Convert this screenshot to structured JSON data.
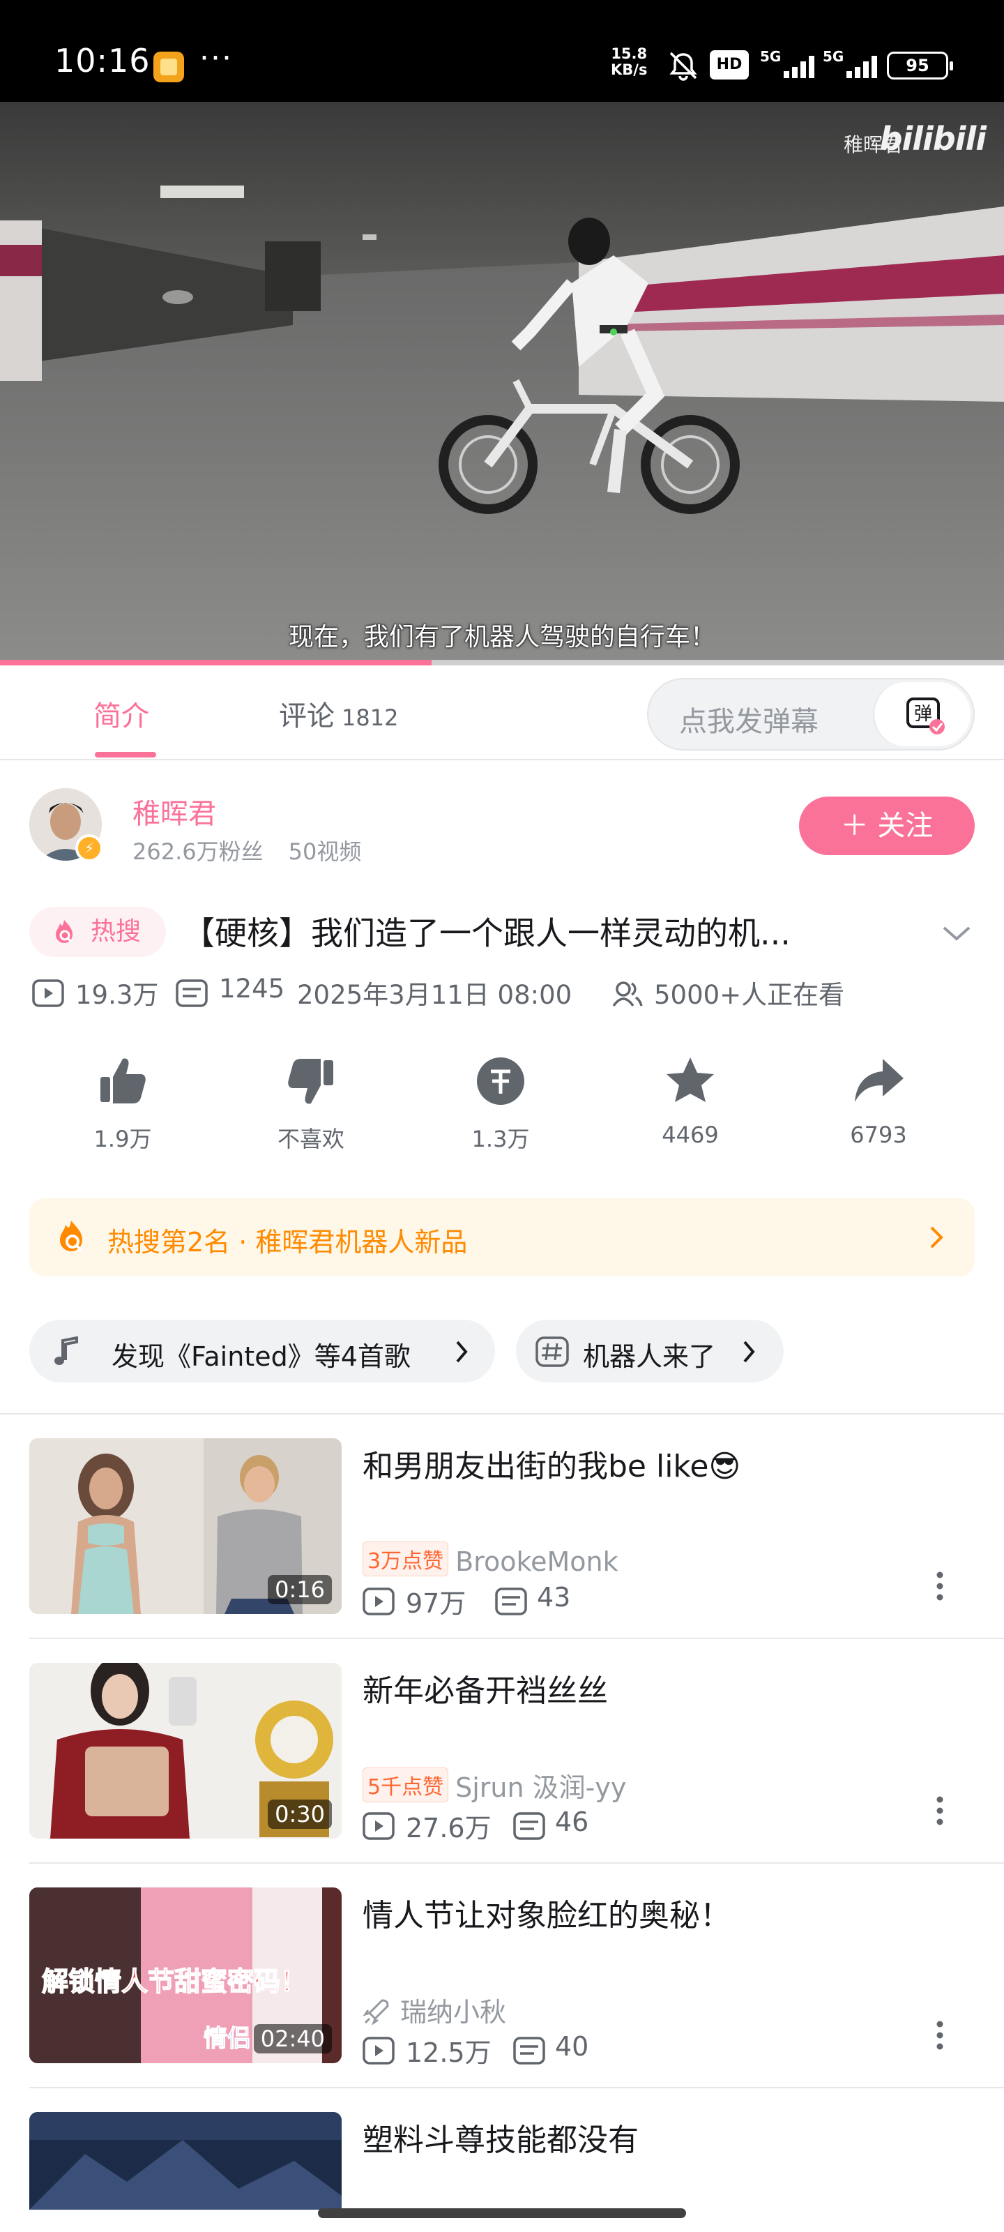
{
  "status_bar": {
    "time": "10:16",
    "menu_dots": "···",
    "net_speed_value": "15.8",
    "net_speed_unit": "KB/s",
    "hd_label": "HD",
    "signal_1_label": "5G",
    "signal_2_label": "5G",
    "battery": "95",
    "icons": [
      "app-notification-icon",
      "mute-bell-icon",
      "hd-icon",
      "signal-icon",
      "battery-icon"
    ]
  },
  "video": {
    "watermark_name": "稚晖君",
    "watermark_logo": "bilibili",
    "subtitle": "现在，我们有了机器人驾驶的自行车！",
    "progress": 0.43
  },
  "tabs": {
    "intro_label": "简介",
    "comments_label": "评论",
    "comments_count": "1812",
    "danmaku_placeholder": "点我发弹幕",
    "danmaku_icon": "弹"
  },
  "uploader": {
    "name": "稚晖君",
    "fans": "262.6万粉丝",
    "videos": "50视频",
    "follow_label": "＋ 关注"
  },
  "video_info": {
    "hot_badge": "热搜",
    "title": "【硬核】我们造了一个跟人一样灵动的机...",
    "views": "19.3万",
    "danmaku_count": "1245",
    "date": "2025年3月11日 08:00",
    "watching": "5000+人正在看"
  },
  "actions": [
    {
      "label": "1.9万",
      "icon": "like-icon"
    },
    {
      "label": "不喜欢",
      "icon": "dislike-icon"
    },
    {
      "label": "1.3万",
      "icon": "coin-icon"
    },
    {
      "label": "4469",
      "icon": "favorite-star-icon"
    },
    {
      "label": "6793",
      "icon": "share-icon"
    }
  ],
  "hot_search": {
    "text": "热搜第2名 · 稚晖君机器人新品"
  },
  "chips": {
    "music": "发现《Fainted》等4首歌",
    "topic": "机器人来了"
  },
  "recommendations": [
    {
      "title": "和男朋友出街的我be like😎",
      "duration": "0:16",
      "likes_badge": "3万点赞",
      "author": "BrookeMonk",
      "views": "97万",
      "danmaku": "43"
    },
    {
      "title": "新年必备开裆丝丝",
      "duration": "0:30",
      "likes_badge": "5千点赞",
      "author": "Sjrun 汲润-yy",
      "views": "27.6万",
      "danmaku": "46"
    },
    {
      "title": "情人节让对象脸红的奥秘！",
      "duration": "02:40",
      "likes_badge": "",
      "author": "瑞纳小秋",
      "views": "12.5万",
      "danmaku": "40",
      "thumb_caption_1": "解锁情人节甜蜜密码！",
      "thumb_caption_2": "情侣"
    },
    {
      "title": "塑料斗尊技能都没有",
      "duration": "",
      "likes_badge": "",
      "author": "",
      "views": "",
      "danmaku": ""
    }
  ],
  "colors": {
    "accent": "#fb7299",
    "hot_orange": "#ff8a00",
    "text_primary": "#18191c",
    "text_secondary": "#61666d",
    "text_tertiary": "#9499a0"
  }
}
